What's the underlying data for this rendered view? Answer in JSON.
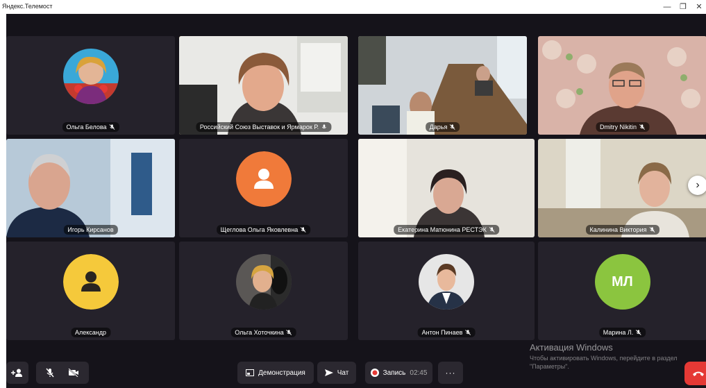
{
  "app": {
    "title": "Яндекс.Телемост"
  },
  "window_controls": {
    "minimize": "—",
    "maximize": "❐",
    "close": "✕"
  },
  "participants": [
    {
      "name": "Ольга Белова",
      "muted": true,
      "view": "avatar-photo"
    },
    {
      "name": "Российский Союз Выставок и Ярмарок Р.",
      "muted": true,
      "view": "video",
      "speaking": true
    },
    {
      "name": "Дарья",
      "muted": true,
      "view": "video"
    },
    {
      "name": "Dmitry Nikitin",
      "muted": true,
      "view": "video"
    },
    {
      "name": "Игорь Кирсанов",
      "muted": false,
      "view": "video"
    },
    {
      "name": "Щеглова Ольга Яковлевна",
      "muted": true,
      "view": "avatar-placeholder",
      "color": "#f07a3a"
    },
    {
      "name": "Екатерина Матюнина РЕСТЭК",
      "muted": true,
      "view": "video"
    },
    {
      "name": "Калинина Виктория",
      "muted": true,
      "view": "video"
    },
    {
      "name": "Александр",
      "muted": false,
      "view": "avatar-placeholder",
      "color": "#f5c93b"
    },
    {
      "name": "Ольга Хоточкина",
      "muted": true,
      "view": "avatar-photo"
    },
    {
      "name": "Антон Пинаев",
      "muted": true,
      "view": "avatar-photo"
    },
    {
      "name": "Марина Л.",
      "muted": true,
      "view": "avatar-initials",
      "initials": "МЛ",
      "color": "#8bc53f"
    }
  ],
  "toolbar": {
    "demo_label": "Демонстрация",
    "chat_label": "Чат",
    "record_label": "Запись",
    "record_time": "02:45",
    "more_label": "···"
  },
  "activation": {
    "title": "Активация Windows",
    "text": "Чтобы активировать Windows, перейдите в раздел \"Параметры\"."
  },
  "colors": {
    "stage": "#15131a",
    "tile": "#25222b",
    "active_border": "#f6c930",
    "hangup": "#e53935",
    "record_dot": "#e53935"
  }
}
